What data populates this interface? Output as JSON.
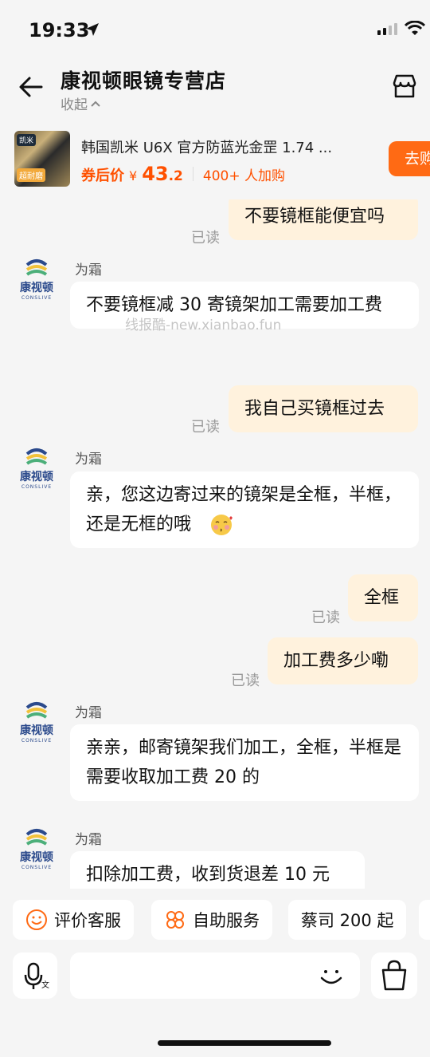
{
  "status_bar": {
    "time": "19:33"
  },
  "header": {
    "store_name": "康视顿眼镜专营店",
    "collapse_label": "收起",
    "collapse_icon": "chevron-up-icon"
  },
  "product": {
    "title": "韩国凯米 U6X 官方防蓝光金罡 1.74 ...",
    "price_label": "券后价",
    "currency": "¥",
    "price_int": "43",
    "price_dec": ".2",
    "buyers": "400+ 人加购",
    "go_button": "去购",
    "thumb_top": "凯米",
    "thumb_badge": "超耐磨"
  },
  "watermark": "线报酷-new.xianbao.fun",
  "avatar": {
    "name_cn": "康视顿",
    "name_en": "CONSLIVE"
  },
  "messages": [
    {
      "side": "mine",
      "text": "不要镜框能便宜吗",
      "status": "已读"
    },
    {
      "side": "theirs",
      "sender": "为霜",
      "text": "不要镜框减 30 寄镜架加工需要加工费"
    },
    {
      "side": "mine",
      "text": "我自己买镜框过去",
      "status": "已读"
    },
    {
      "side": "theirs",
      "sender": "为霜",
      "text": "亲，您这边寄过来的镜架是全框，半框，还是无框的哦"
    },
    {
      "side": "mine",
      "text": "全框",
      "status": "已读"
    },
    {
      "side": "mine",
      "text": "加工费多少嘞",
      "status": "已读"
    },
    {
      "side": "theirs",
      "sender": "为霜",
      "text": "亲亲，邮寄镜架我们加工，全框，半框是需要收取加工费 20 的"
    },
    {
      "side": "theirs",
      "sender": "为霜",
      "text": "扣除加工费，收到货退差 10 元"
    }
  ],
  "quick_actions": [
    {
      "label": "评价客服",
      "icon": "smiley-icon"
    },
    {
      "label": "自助服务",
      "icon": "grid-flower-icon"
    },
    {
      "label": "蔡司 200 起",
      "icon": ""
    }
  ],
  "input": {
    "placeholder": ""
  },
  "colors": {
    "accent": "#ff5000",
    "mine_bubble": "#fff2dd",
    "background": "#f5f5f5"
  }
}
